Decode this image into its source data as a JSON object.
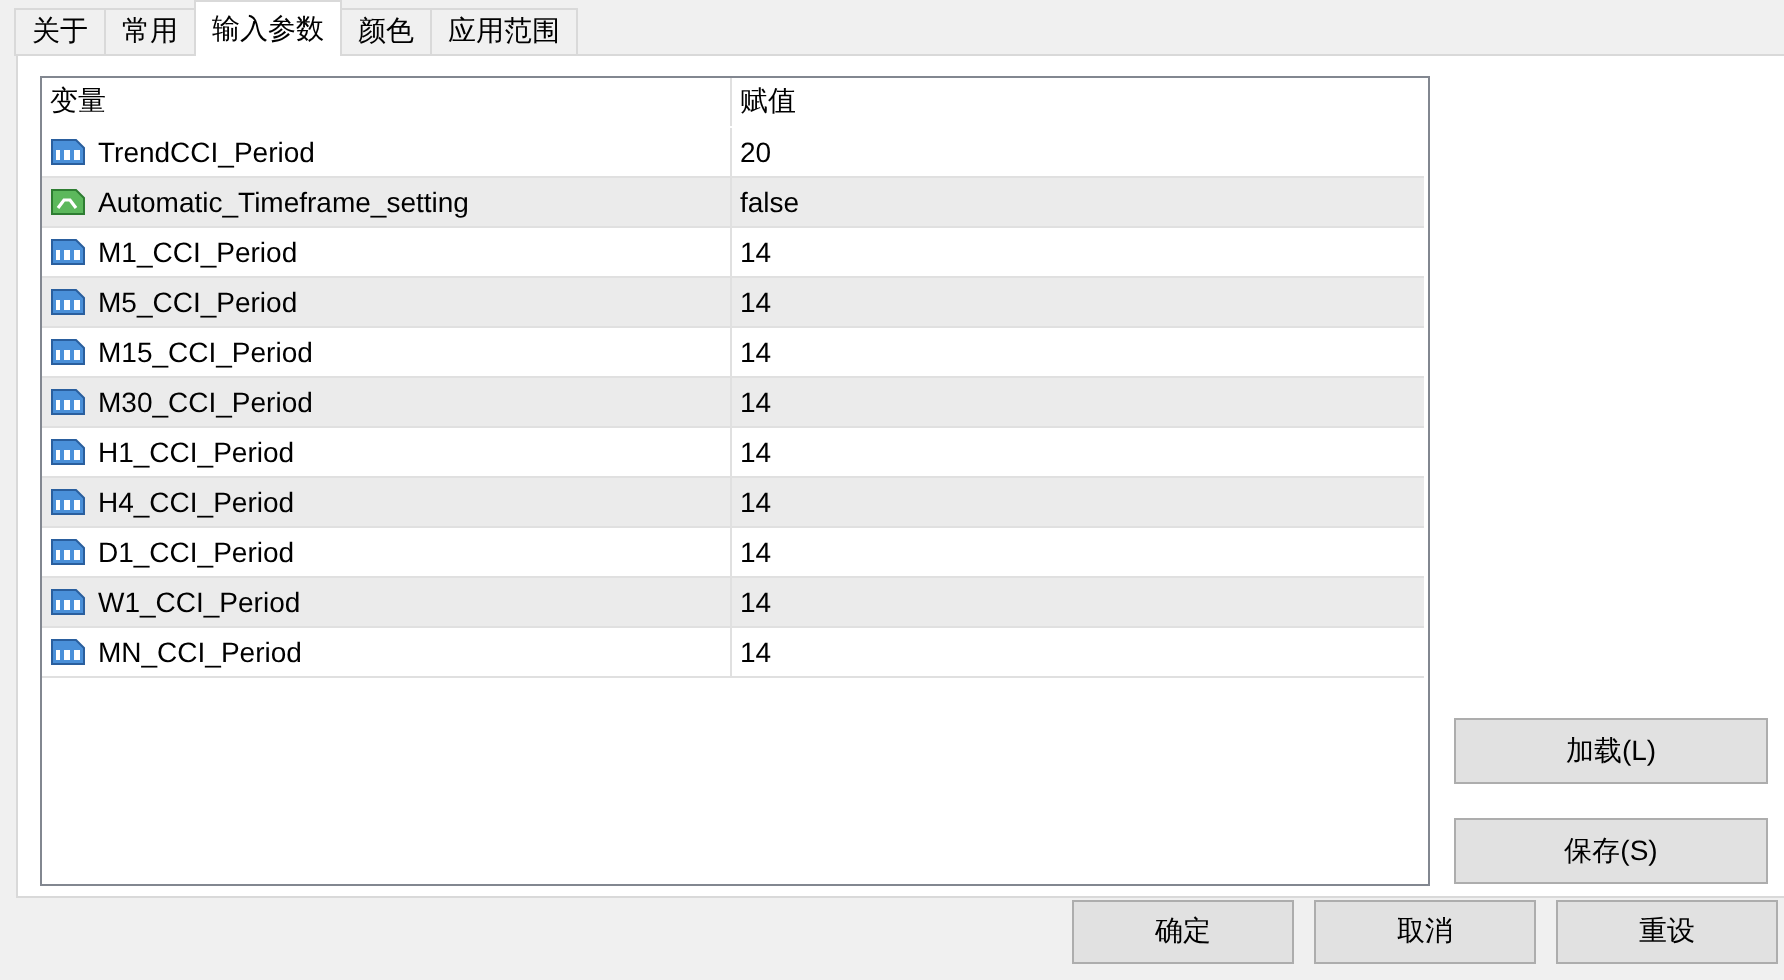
{
  "tabs": [
    {
      "label": "关于",
      "selected": false
    },
    {
      "label": "常用",
      "selected": false
    },
    {
      "label": "输入参数",
      "selected": true
    },
    {
      "label": "颜色",
      "selected": false
    },
    {
      "label": "应用范围",
      "selected": false
    }
  ],
  "table": {
    "columns": [
      "变量",
      "赋值"
    ],
    "rows": [
      {
        "kind": "number",
        "name": "TrendCCI_Period",
        "value": "20"
      },
      {
        "kind": "bool",
        "name": "Automatic_Timeframe_setting",
        "value": "false"
      },
      {
        "kind": "number",
        "name": "M1_CCI_Period",
        "value": "14"
      },
      {
        "kind": "number",
        "name": "M5_CCI_Period",
        "value": "14"
      },
      {
        "kind": "number",
        "name": "M15_CCI_Period",
        "value": "14"
      },
      {
        "kind": "number",
        "name": "M30_CCI_Period",
        "value": "14"
      },
      {
        "kind": "number",
        "name": "H1_CCI_Period",
        "value": "14"
      },
      {
        "kind": "number",
        "name": "H4_CCI_Period",
        "value": "14"
      },
      {
        "kind": "number",
        "name": "D1_CCI_Period",
        "value": "14"
      },
      {
        "kind": "number",
        "name": "W1_CCI_Period",
        "value": "14"
      },
      {
        "kind": "number",
        "name": "MN_CCI_Period",
        "value": "14"
      }
    ]
  },
  "side_buttons": [
    "加载(L)",
    "保存(S)"
  ],
  "dialog_buttons": [
    "确定",
    "取消",
    "重设"
  ]
}
